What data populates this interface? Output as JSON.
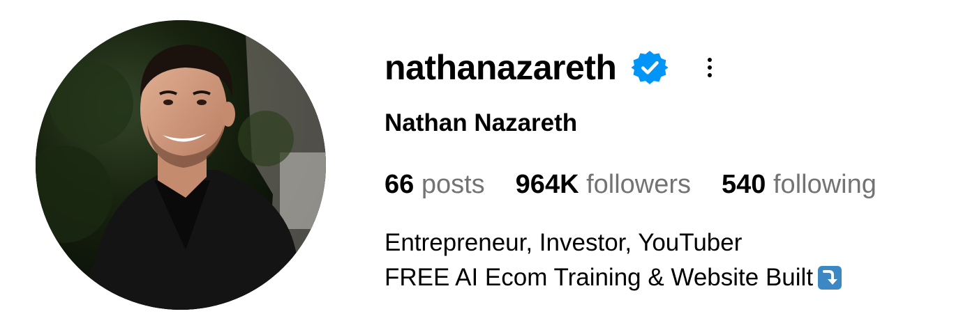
{
  "profile": {
    "username": "nathanazareth",
    "full_name": "Nathan Nazareth",
    "verified": true,
    "avatar_icon": "profile-photo",
    "more_icon": "more-vertical-icon"
  },
  "stats": {
    "posts": {
      "count": "66",
      "label": "posts"
    },
    "followers": {
      "count": "964K",
      "label": "followers"
    },
    "following": {
      "count": "540",
      "label": "following"
    }
  },
  "bio": {
    "line1": "Entrepreneur, Investor, YouTuber",
    "line2": "FREE AI Ecom Training & Website Built",
    "line2_emoji": "arrow-down-right-emoji"
  },
  "colors": {
    "verified_blue": "#0095F6",
    "secondary_text": "#737373",
    "primary_text": "#000000",
    "emoji_blue": "#3B88C3"
  }
}
